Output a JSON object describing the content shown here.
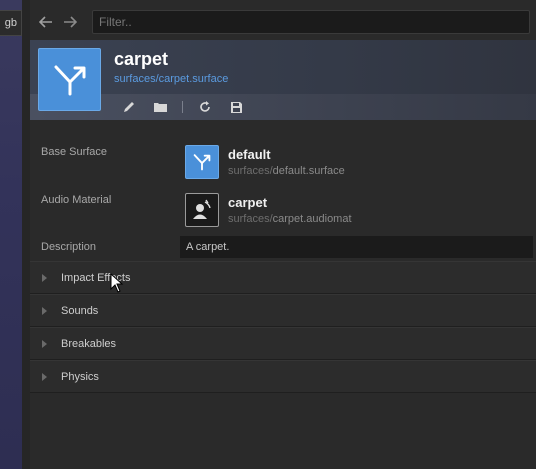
{
  "background": {
    "tab_label": "gb"
  },
  "toolbar": {
    "back_icon": "arrow-left-icon",
    "forward_icon": "arrow-right-icon",
    "filter_placeholder": "Filter.."
  },
  "header": {
    "title": "carpet",
    "path": "surfaces/carpet.surface",
    "icon": "surface-branch-icon",
    "accent": "#4a90d9",
    "actions": [
      {
        "name": "edit",
        "icon": "pencil-icon"
      },
      {
        "name": "folder",
        "icon": "folder-icon"
      },
      {
        "name": "refresh",
        "icon": "refresh-icon"
      },
      {
        "name": "save",
        "icon": "save-icon"
      }
    ]
  },
  "properties": {
    "base_surface": {
      "label": "Base Surface",
      "name": "default",
      "path_dir": "surfaces/",
      "path_file": "default.surface"
    },
    "audio_material": {
      "label": "Audio Material",
      "name": "carpet",
      "path_dir": "surfaces/",
      "path_file": "carpet.audiomat"
    },
    "description": {
      "label": "Description",
      "value": "A carpet."
    }
  },
  "sections": [
    {
      "label": "Impact Effects"
    },
    {
      "label": "Sounds"
    },
    {
      "label": "Breakables"
    },
    {
      "label": "Physics"
    }
  ]
}
